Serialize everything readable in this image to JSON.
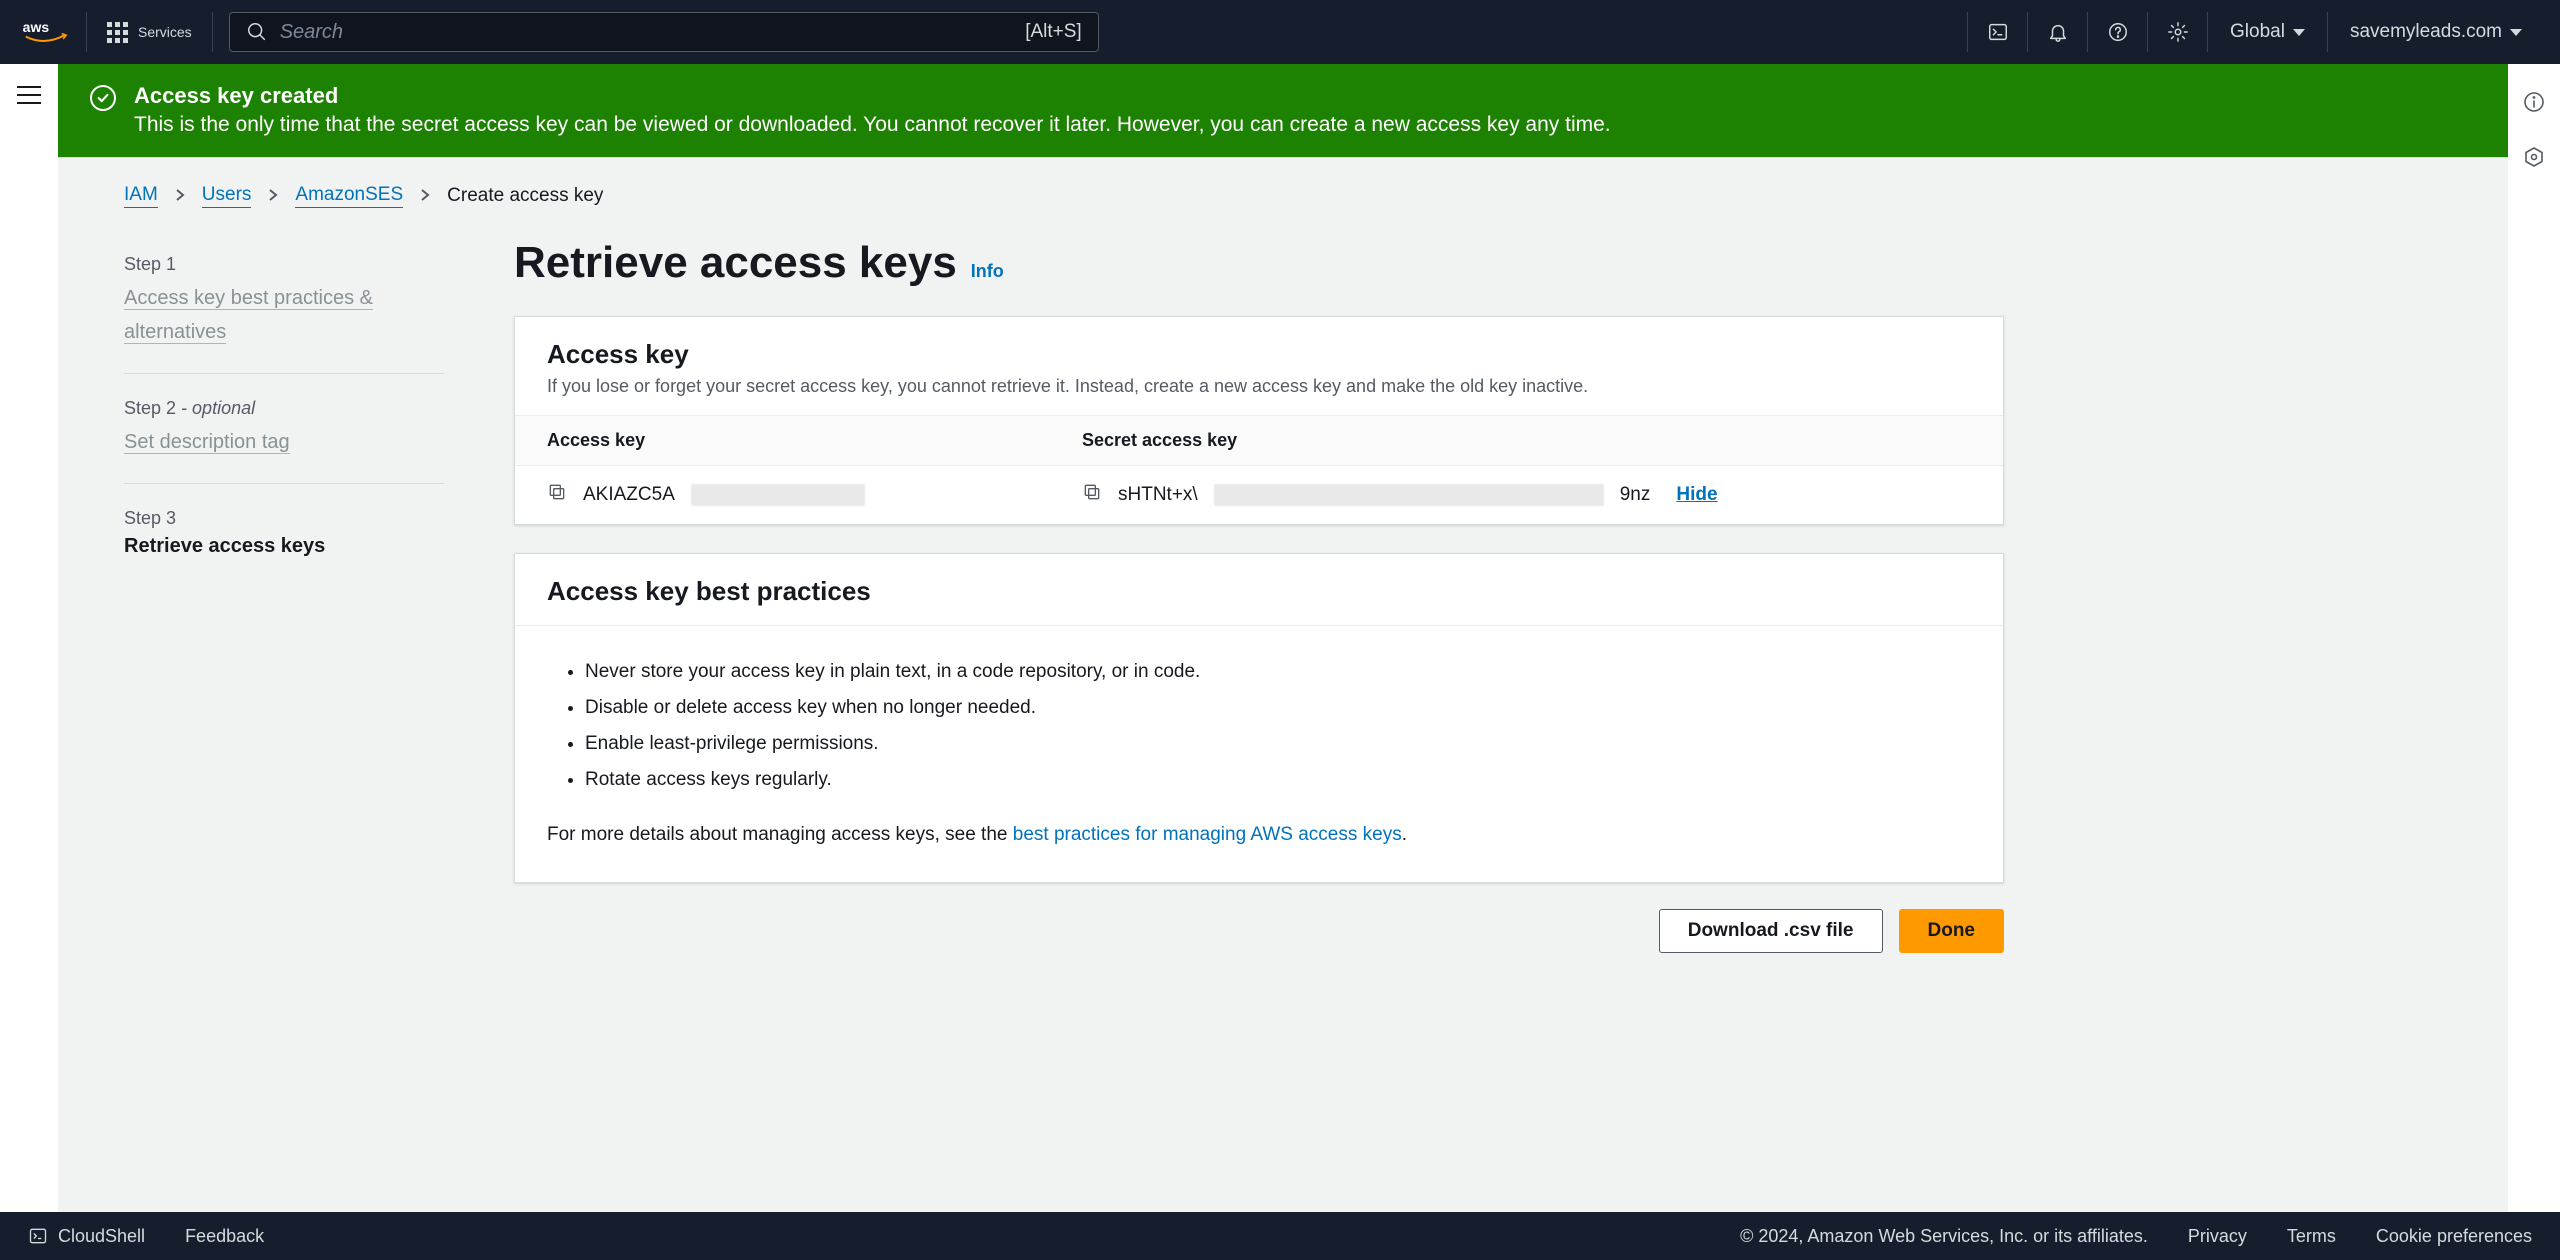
{
  "topnav": {
    "services_label": "Services",
    "search_placeholder": "Search",
    "search_hint": "[Alt+S]",
    "region": "Global",
    "account": "savemyleads.com"
  },
  "banner": {
    "title": "Access key created",
    "message": "This is the only time that the secret access key can be viewed or downloaded. You cannot recover it later. However, you can create a new access key any time."
  },
  "breadcrumbs": {
    "iam": "IAM",
    "users": "Users",
    "user_name": "AmazonSES",
    "current": "Create access key"
  },
  "wizard": {
    "step1_label": "Step 1",
    "step1_title": "Access key best practices & alternatives",
    "step2_label": "Step 2 ",
    "step2_optional_suffix": "- optional",
    "step2_title": "Set description tag",
    "step3_label": "Step 3",
    "step3_title": "Retrieve access keys"
  },
  "page": {
    "title": "Retrieve access keys",
    "info_label": "Info"
  },
  "access_key_panel": {
    "heading": "Access key",
    "subtext": "If you lose or forget your secret access key, you cannot retrieve it. Instead, create a new access key and make the old key inactive.",
    "col_access": "Access key",
    "col_secret": "Secret access key",
    "access_prefix": "AKIAZC5A",
    "secret_prefix": "sHTNt+x\\",
    "secret_suffix": "9nz",
    "hide_label": "Hide"
  },
  "best_practices_panel": {
    "heading": "Access key best practices",
    "items": [
      "Never store your access key in plain text, in a code repository, or in code.",
      "Disable or delete access key when no longer needed.",
      "Enable least-privilege permissions.",
      "Rotate access keys regularly."
    ],
    "more_prefix": "For more details about managing access keys, see the ",
    "more_link": "best practices for managing AWS access keys",
    "more_suffix": "."
  },
  "actions": {
    "download_label": "Download .csv file",
    "done_label": "Done"
  },
  "footer": {
    "cloudshell": "CloudShell",
    "feedback": "Feedback",
    "copyright": "© 2024, Amazon Web Services, Inc. or its affiliates.",
    "privacy": "Privacy",
    "terms": "Terms",
    "cookies": "Cookie preferences"
  }
}
